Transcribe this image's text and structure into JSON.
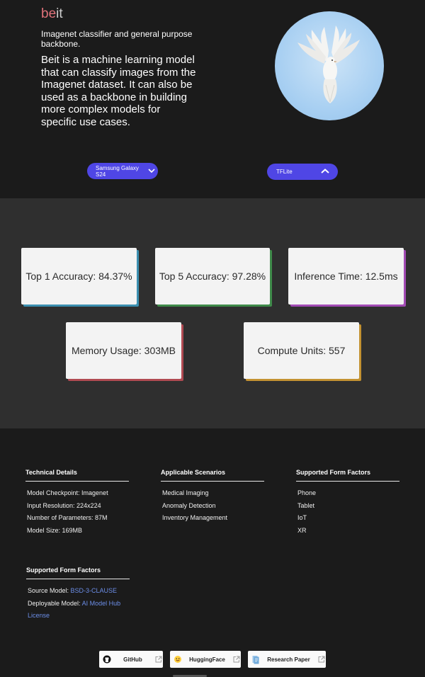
{
  "hero": {
    "brand_highlight": "be",
    "brand_rest": "it",
    "subtitle": "Imagenet classifier and general purpose backbone.",
    "description": "Beit is a machine learning model that can classify images from the Imagenet dataset. It can also be used as a backbone in building more complex models for specific use cases.",
    "device_select": "Samsung Galaxy S24",
    "runtime_select": "TFLite"
  },
  "metrics": [
    {
      "label": "Top 1 Accuracy: 84.37%",
      "accent": "#3b8fb0"
    },
    {
      "label": "Top 5 Accuracy: 97.28%",
      "accent": "#3f8a4a"
    },
    {
      "label": "Inference Time: 12.5ms",
      "accent": "#a24bb4"
    },
    {
      "label": "Memory Usage: 303MB",
      "accent": "#b04a52"
    },
    {
      "label": "Compute Units: 557",
      "accent": "#c39232"
    }
  ],
  "footer": {
    "technical": {
      "title": "Technical Details",
      "items": [
        "Model Checkpoint: Imagenet",
        "Input Resolution: 224x224",
        "Number of Parameters: 87M",
        "Model Size: 169MB"
      ]
    },
    "scenarios": {
      "title": "Applicable Scenarios",
      "items": [
        "Medical Imaging",
        "Anomaly Detection",
        "Inventory Management"
      ]
    },
    "form_factors": {
      "title": "Supported Form Factors",
      "items": [
        "Phone",
        "Tablet",
        "IoT",
        "XR"
      ]
    },
    "licenses": {
      "title": "Supported Form Factors",
      "source_label": "Source Model: ",
      "source_link": "BSD-3-CLAUSE",
      "deploy_label": "Deployable Model: ",
      "deploy_link_1": "AI Model Hub",
      "deploy_link_2": "License"
    }
  },
  "links": {
    "github": "GitHub",
    "huggingface": "HuggingFace",
    "paper": "Research Paper"
  },
  "colors": {
    "accent_button": "#4f46e5",
    "link": "#6c8ee8",
    "brand_highlight": "#e0727a"
  }
}
